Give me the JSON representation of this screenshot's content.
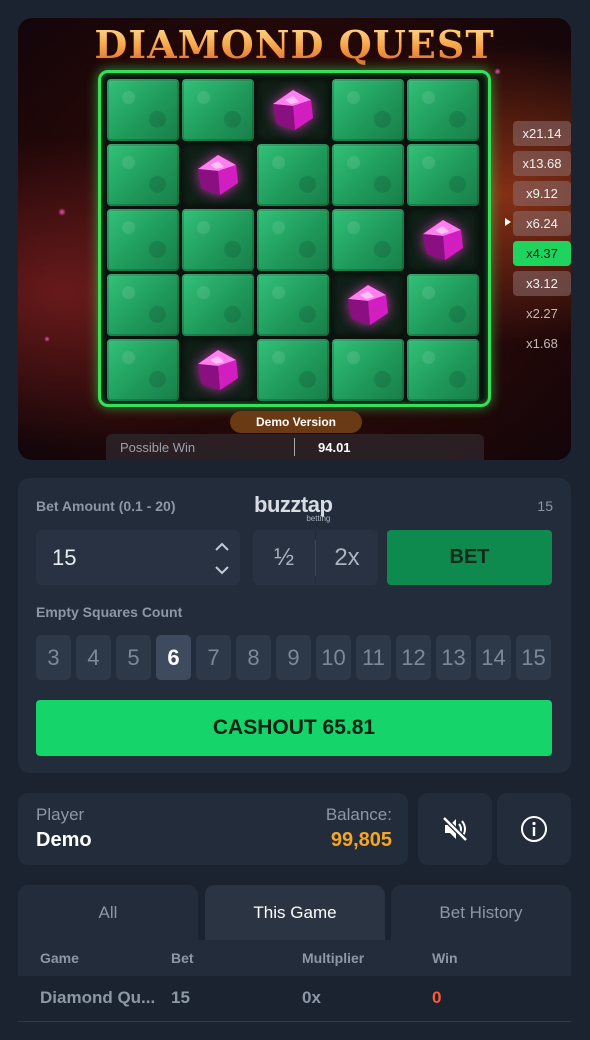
{
  "game": {
    "title": "DIAMOND QUEST",
    "grid": [
      [
        "tile",
        "tile",
        "gem",
        "tile",
        "tile"
      ],
      [
        "tile",
        "gem",
        "tile",
        "tile",
        "tile"
      ],
      [
        "tile",
        "tile",
        "tile",
        "tile",
        "gem"
      ],
      [
        "tile",
        "tile",
        "tile",
        "gem",
        "tile"
      ],
      [
        "tile",
        "gem",
        "tile",
        "tile",
        "tile"
      ]
    ],
    "multipliers": [
      "x21.14",
      "x13.68",
      "x9.12",
      "x6.24",
      "x4.37",
      "x3.12",
      "x2.27",
      "x1.68"
    ],
    "active_multiplier": "x4.37",
    "demo_label": "Demo Version",
    "possible_win_label": "Possible Win",
    "possible_win_value": "94.01",
    "colors": {
      "tile": "#1f9a5a",
      "board_border": "#35e05a",
      "gem": "#e236c8"
    }
  },
  "controls": {
    "bet_label": "Bet Amount (0.1 - 20)",
    "logo": "buzztap",
    "logo_sub": "betting",
    "bet_max_display": "15",
    "bet_value": "15",
    "half_label": "½",
    "double_label": "2x",
    "bet_button": "BET",
    "empty_label": "Empty Squares Count",
    "counts": [
      "3",
      "4",
      "5",
      "6",
      "7",
      "8",
      "9",
      "10",
      "11",
      "12",
      "13",
      "14",
      "15"
    ],
    "selected_count": "6",
    "cashout_label": "CASHOUT 65.81",
    "colors": {
      "bet_button": "#0e8a4f",
      "cashout": "#14d46a"
    }
  },
  "player": {
    "label": "Player",
    "name": "Demo",
    "balance_label": "Balance:",
    "balance": "99,805",
    "icons": [
      "sound-muted-icon",
      "info-icon"
    ]
  },
  "history": {
    "tabs": [
      "All",
      "This Game",
      "Bet History"
    ],
    "active_tab": "This Game",
    "columns": [
      "Game",
      "Bet",
      "Multiplier",
      "Win"
    ],
    "rows": [
      {
        "game": "Diamond Qu...",
        "bet": "15",
        "multiplier": "0x",
        "win": "0"
      }
    ]
  }
}
